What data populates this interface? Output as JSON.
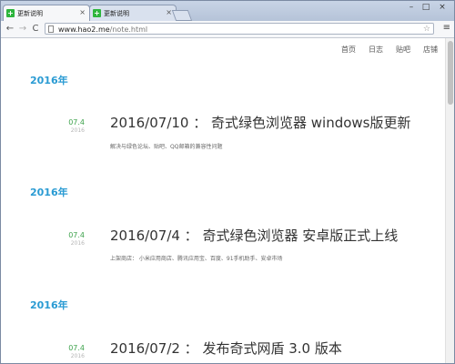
{
  "browser": {
    "tabs": [
      {
        "title": "更新说明",
        "favicon": "plus-favicon"
      },
      {
        "title": "更新说明",
        "favicon": "plus-favicon"
      }
    ],
    "tab_close": "×",
    "window_controls": {
      "minimize": "–",
      "maximize": "□",
      "close": "×"
    },
    "nav": {
      "back": "←",
      "forward": "→",
      "reload": "C"
    },
    "url": {
      "host": "www.hao2.me",
      "path": "/note.html"
    },
    "star": "☆",
    "menu": "≡"
  },
  "site_nav": [
    "首页",
    "日志",
    "贴吧",
    "店铺"
  ],
  "entries": [
    {
      "year_heading": "2016年",
      "date_md": "07.4",
      "date_year": "2016",
      "title": "2016/07/10 ： 奇式绿色浏览器 windows版更新",
      "desc": "解决与绿色论坛、贴吧、QQ邮箱的兼容性问题"
    },
    {
      "year_heading": "2016年",
      "date_md": "07.4",
      "date_year": "2016",
      "title": "2016/07/4 ： 奇式绿色浏览器 安卓版正式上线",
      "desc": "上架商店： 小米应用商店、腾讯应用宝、百度、91手机助手、安卓市场"
    },
    {
      "year_heading": "2016年",
      "date_md": "07.4",
      "date_year": "2016",
      "title": "2016/07/2 ： 发布奇式网盾 3.0 版本",
      "desc": ""
    }
  ],
  "colors": {
    "accent": "#2a9bd3",
    "date_green": "#3fa34d",
    "favicon_green": "#2db53c"
  }
}
